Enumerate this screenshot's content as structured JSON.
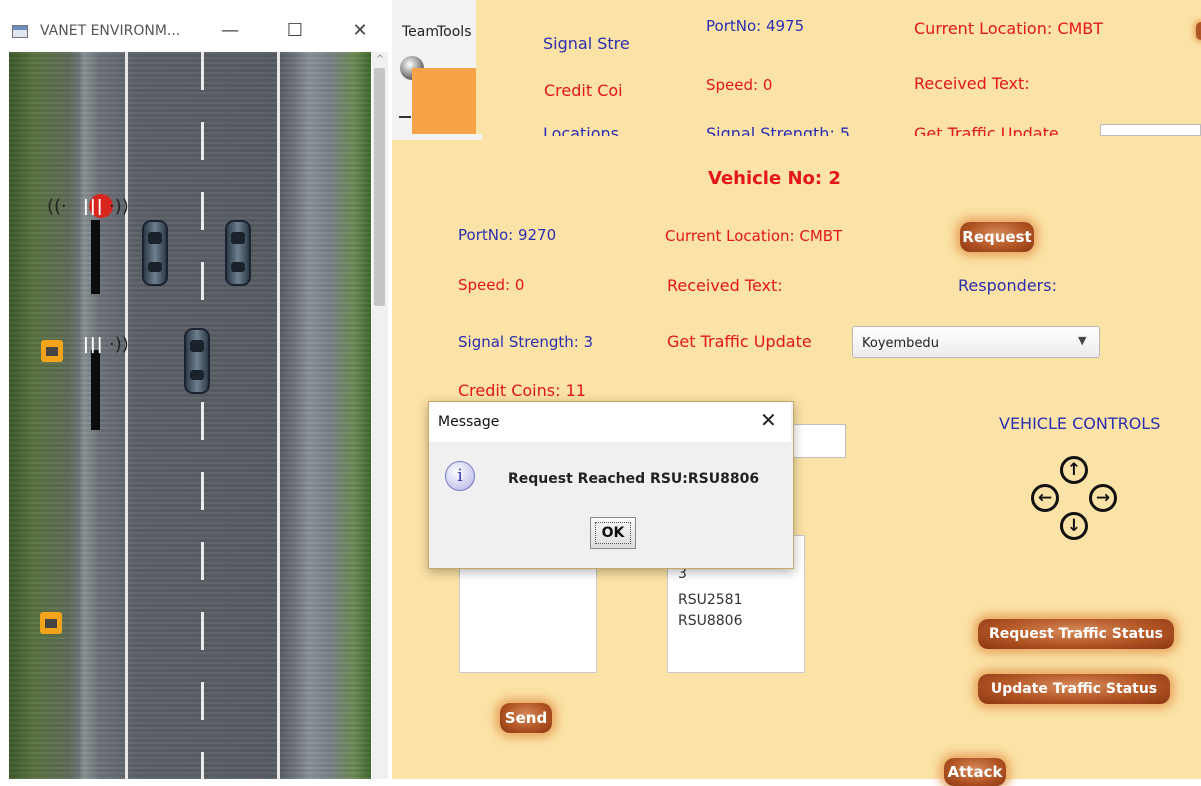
{
  "vanet_window": {
    "title": "VANET ENVIRONM...",
    "minimize": "—",
    "maximize": "☐",
    "close": "✕",
    "scroll_up": "^",
    "tower_bars": "|||",
    "signal_waves_left": "((·",
    "signal_waves_right": "·))"
  },
  "menu": {
    "team": "Team",
    "tools": "Tools"
  },
  "back_vehicle": {
    "signal_strength": "Signal Stre",
    "credit_coins": "Credit Coi",
    "port_no": "PortNo: 4975",
    "speed": "Speed:  0",
    "signal_strength_full": "Signal Strength: 5",
    "current_location": "Current Location: CMBT",
    "received_text": "Received Text:",
    "get_traffic_update": "Get Traffic Update",
    "cut_label": "Locations"
  },
  "vehicle": {
    "heading": "Vehicle No:  2",
    "port_no": "PortNo: 9270",
    "current_location": "Current Location: CMBT",
    "request_button": "Request",
    "speed": "Speed:  0",
    "received_text": "Received Text:",
    "responders": "Responders:",
    "signal_strength": "Signal Strength: 3",
    "get_traffic_update": "Get Traffic Update",
    "traffic_location_selected": "Koyembedu",
    "credit_coins": "Credit Coins:  11",
    "vehicle_controls": "VEHICLE CONTROLS",
    "responders_list": [
      "3",
      "RSU2581",
      "RSU8806"
    ],
    "request_traffic_status_button": "Request Traffic Status",
    "update_traffic_status_button": "Update Traffic Status",
    "send_button": "Send",
    "attack_button": "Attack",
    "arrows": {
      "up": "↑",
      "down": "↓",
      "left": "←",
      "right": "→"
    },
    "combo_arrow": "▼"
  },
  "dialog": {
    "title": "Message",
    "close": "✕",
    "icon": "i",
    "message": "Request Reached RSU:RSU8806",
    "ok": "OK"
  },
  "colors": {
    "app_background": "#fbe2a6",
    "blue_label": "#2a2fae",
    "red_label": "#e4161c",
    "button": "#b25524",
    "button_glow": "#e7a15a"
  }
}
